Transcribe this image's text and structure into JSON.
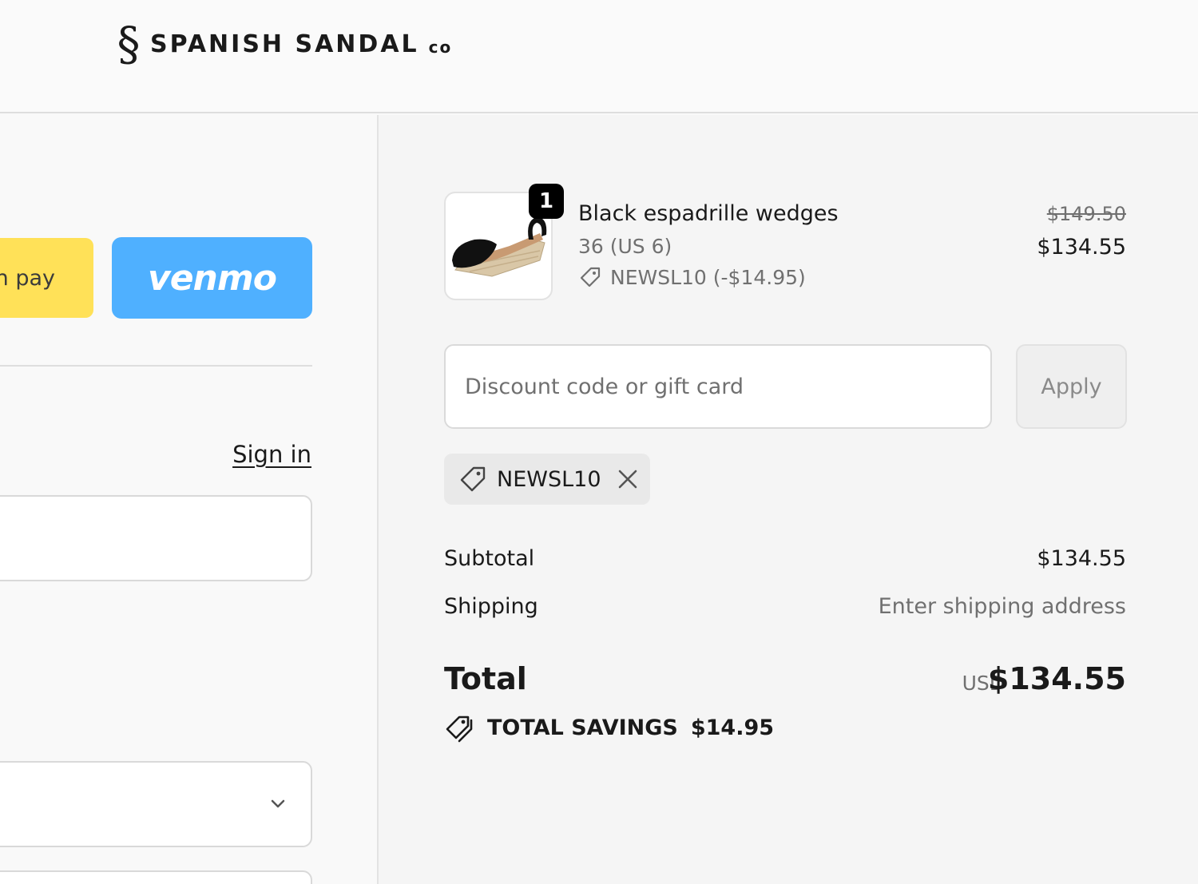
{
  "brand": {
    "mark": "§",
    "name": "SPANISH SANDAL",
    "suffix": "co"
  },
  "express": {
    "yellow_label": "n pay",
    "venmo_label": "venmo"
  },
  "account": {
    "sign_in": "Sign in"
  },
  "order": {
    "item": {
      "name": "Black espadrille wedges",
      "variant": "36 (US 6)",
      "discount": "NEWSL10 (-$14.95)",
      "quantity": "1",
      "price_original": "$149.50",
      "price": "$134.55",
      "image": "black-espadrille-wedge-icon"
    },
    "discount_field": {
      "placeholder": "Discount code or gift card",
      "apply_label": "Apply"
    },
    "applied_code": "NEWSL10",
    "summary": {
      "subtotal_label": "Subtotal",
      "subtotal_value": "$134.55",
      "shipping_label": "Shipping",
      "shipping_value": "Enter shipping address",
      "total_label": "Total",
      "currency": "USD",
      "total_value": "$134.55",
      "savings_label": "TOTAL SAVINGS",
      "savings_value": "$14.95"
    }
  },
  "colors": {
    "venmo": "#4fb0ff",
    "yellow_pay": "#ffe158",
    "badge": "#000000"
  }
}
